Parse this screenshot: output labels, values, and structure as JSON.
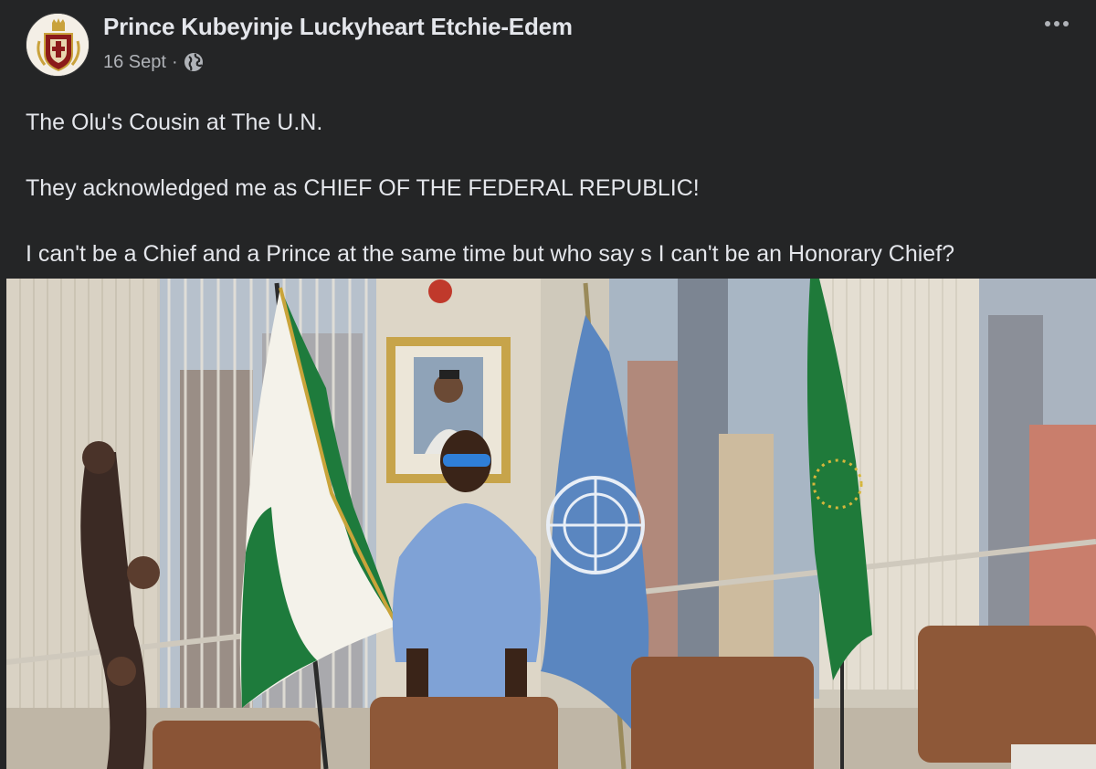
{
  "post": {
    "author": "Prince Kubeyinje Luckyheart Etchie-Edem",
    "date": "16 Sept",
    "separator": "·",
    "audience_icon": "globe-icon",
    "more_icon": "more-options-icon",
    "lines": [
      "The Olu's Cousin at The U.N.",
      "They acknowledged me as CHIEF OF THE FEDERAL REPUBLIC!",
      "I can't be a Chief and a Prince at the same time but who say s I can't be an Honorary Chief?"
    ]
  },
  "colors": {
    "background": "#242526",
    "text_primary": "#e4e6eb",
    "text_secondary": "#b0b3b8",
    "flag_green": "#1e7b3c",
    "un_blue": "#5a86c0",
    "au_green": "#1f7a3a",
    "outfit_blue": "#7fa2d6"
  }
}
